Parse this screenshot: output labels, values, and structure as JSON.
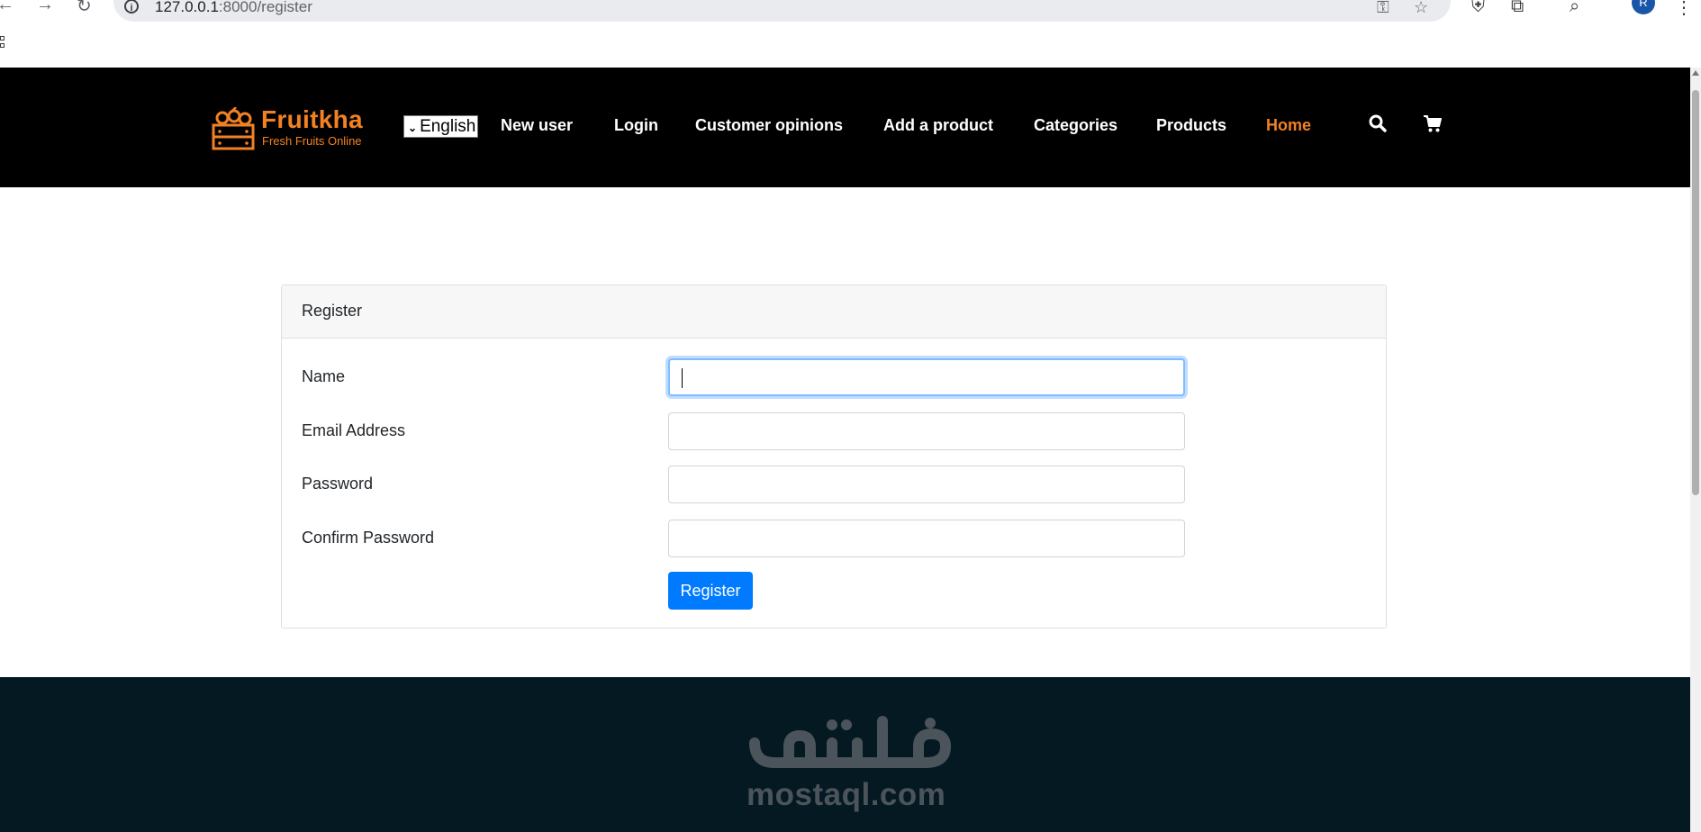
{
  "browser": {
    "url_host": "127.0.0.1",
    "url_path": ":8000/register",
    "avatar_letter": "R"
  },
  "header": {
    "logo_title": "Fruitkha",
    "logo_subtitle": "Fresh Fruits Online",
    "language_selected": "English",
    "menu": [
      {
        "label": "New user"
      },
      {
        "label": "Login"
      },
      {
        "label": "Customer opinions"
      },
      {
        "label": "Add a product"
      },
      {
        "label": "Categories"
      },
      {
        "label": "Products"
      },
      {
        "label": "Home",
        "active": true
      }
    ]
  },
  "form": {
    "title": "Register",
    "fields": [
      {
        "label": "Name",
        "value": ""
      },
      {
        "label": "Email Address",
        "value": ""
      },
      {
        "label": "Password",
        "value": ""
      },
      {
        "label": "Confirm Password",
        "value": ""
      }
    ],
    "submit_label": "Register"
  },
  "footer": {
    "watermark_arabic": "مستقل",
    "watermark_text": "mostaql.com"
  },
  "colors": {
    "accent": "#f28123",
    "header_bg": "#000000",
    "footer_bg": "#051922",
    "primary_button": "#007bff"
  }
}
